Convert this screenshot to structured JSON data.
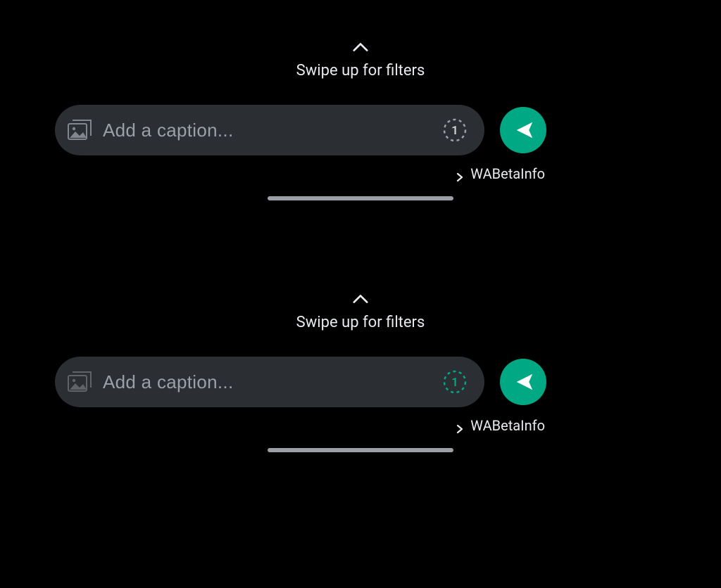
{
  "hint_text": "Swipe up for filters",
  "caption_placeholder": "Add a caption...",
  "recipient_label": "WABetaInfo",
  "view_once_digit": "1",
  "watermark_text": "WABETAINFO",
  "panels": {
    "top": {
      "view_once_active": false
    },
    "bottom": {
      "view_once_active": true
    }
  },
  "colors": {
    "accent": "#00a884",
    "bg": "#000000",
    "pill": "#2b2e32",
    "text_muted": "#9aa0a6"
  }
}
